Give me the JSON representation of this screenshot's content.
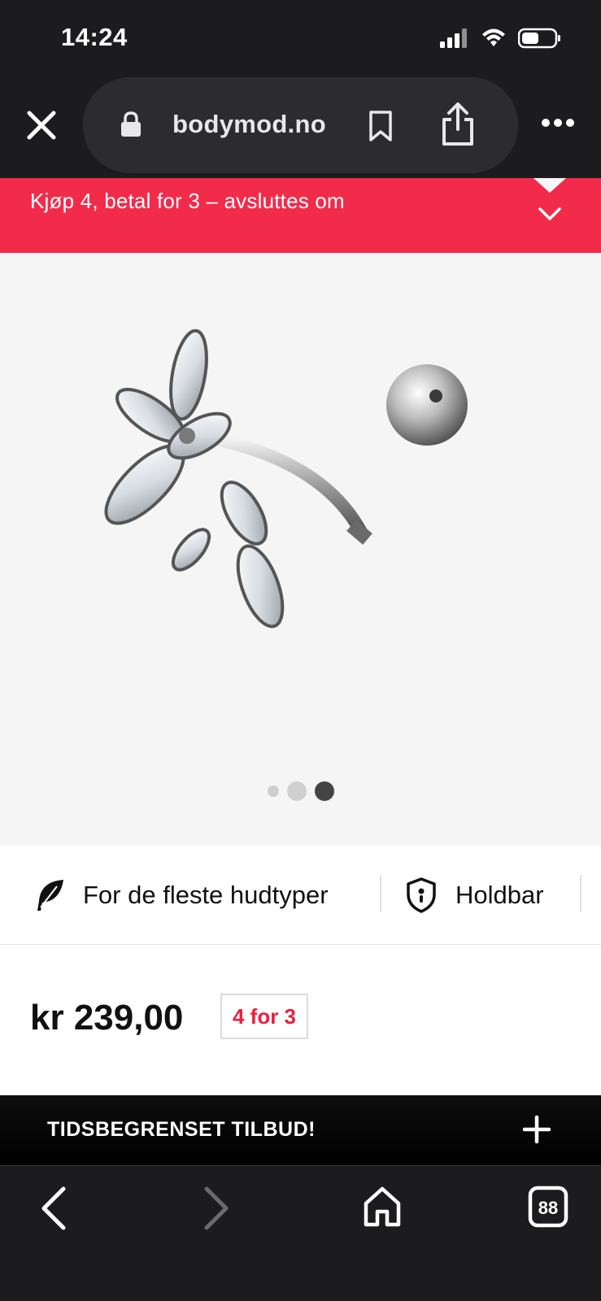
{
  "status": {
    "time": "14:24"
  },
  "browser": {
    "domain": "bodymod.no"
  },
  "promo": {
    "text": "Kjøp 4, betal for 3 – avsluttes om"
  },
  "gallery": {
    "dot_count": 3,
    "active_dot": 3
  },
  "features": [
    {
      "icon": "feather-icon",
      "label": "For de fleste hudtyper"
    },
    {
      "icon": "shield-icon",
      "label": "Holdbar"
    }
  ],
  "product": {
    "price": "kr 239,00",
    "badge": "4 for 3"
  },
  "offer": {
    "title": "TIDSBEGRENSET TILBUD!"
  },
  "colors": {
    "promo": "#f22b4b",
    "badge_text": "#e8213f",
    "dark": "#1c1c1e"
  }
}
